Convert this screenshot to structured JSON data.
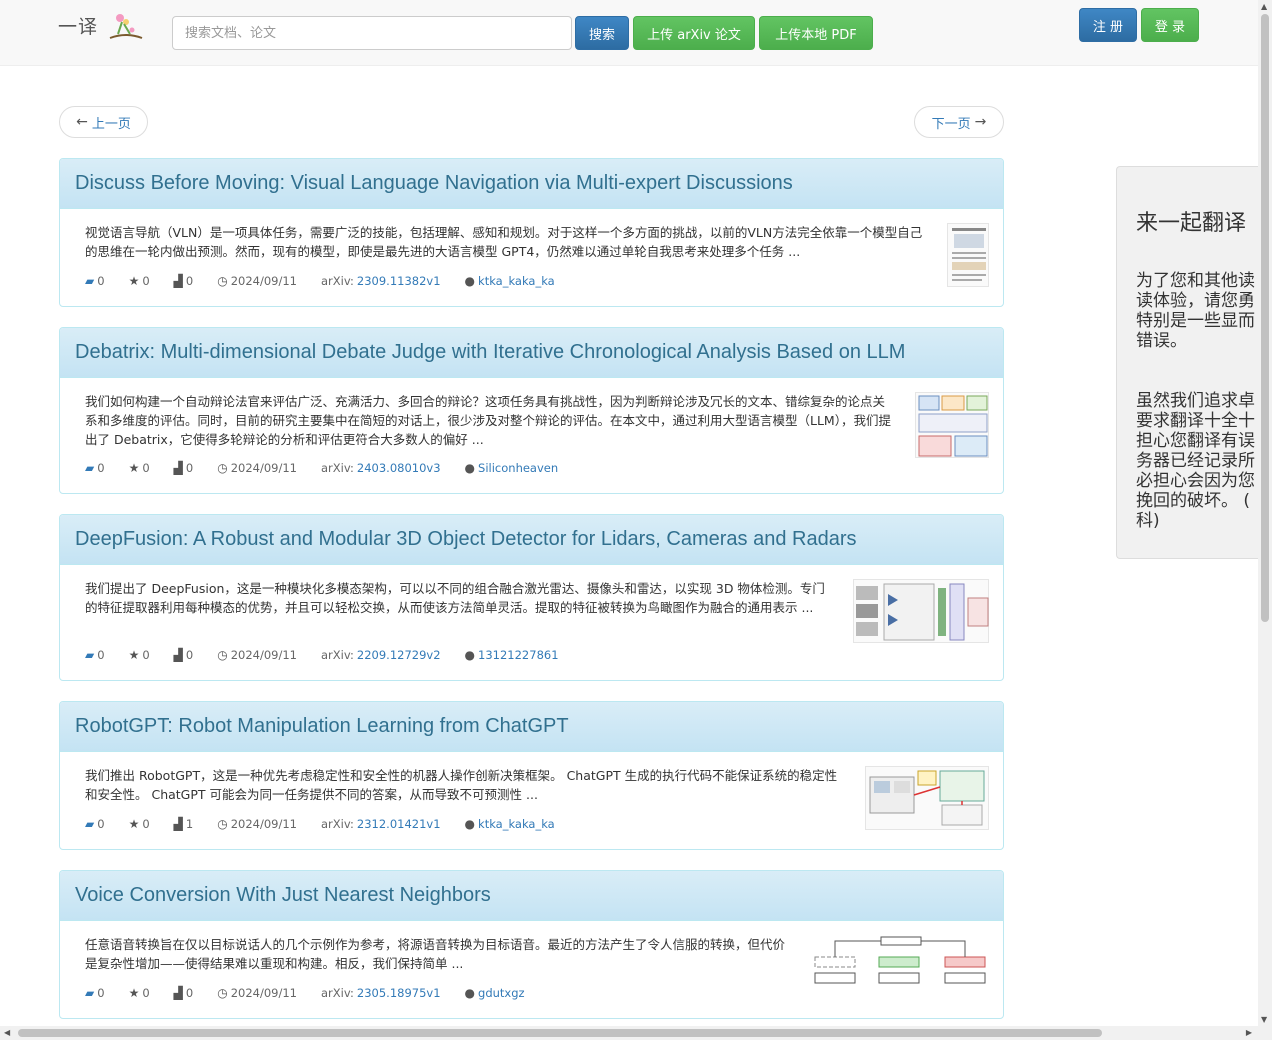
{
  "header": {
    "brand": "一译",
    "search_placeholder": "搜索文档、论文",
    "search_button": "搜索",
    "upload_arxiv": "上传 arXiv 论文",
    "upload_pdf": "上传本地 PDF",
    "register": "注 册",
    "login": "登 录"
  },
  "pager": {
    "prev": "上一页",
    "next": "下一页",
    "prev_arrow": "←",
    "next_arrow": "→"
  },
  "papers": [
    {
      "title": "Discuss Before Moving: Visual Language Navigation via Multi-expert Discussions",
      "abstract": "视觉语言导航（VLN）是一项具体任务，需要广泛的技能，包括理解、感知和规划。对于这样一个多方面的挑战，以前的VLN方法完全依靠一个模型自己的思维在一轮内做出预测。然而，现有的模型，即使是最先进的大语言模型 GPT4，仍然难以通过单轮自我思考来处理多个任务 ...",
      "comments": "0",
      "stars": "0",
      "views": "0",
      "date": "2024/09/11",
      "arxiv_prefix": "arXiv:",
      "arxiv_id": "2309.11382v1",
      "user": "ktka_kaka_ka"
    },
    {
      "title": "Debatrix: Multi-dimensional Debate Judge with Iterative Chronological Analysis Based on LLM",
      "abstract": "我们如何构建一个自动辩论法官来评估广泛、充满活力、多回合的辩论？这项任务具有挑战性，因为判断辩论涉及冗长的文本、错综复杂的论点关系和多维度的评估。同时，目前的研究主要集中在简短的对话上，很少涉及对整个辩论的评估。在本文中，通过利用大型语言模型（LLM），我们提出了 Debatrix，它使得多轮辩论的分析和评估更符合大多数人的偏好 ...",
      "comments": "0",
      "stars": "0",
      "views": "0",
      "date": "2024/09/11",
      "arxiv_prefix": "arXiv:",
      "arxiv_id": "2403.08010v3",
      "user": "Siliconheaven"
    },
    {
      "title": "DeepFusion: A Robust and Modular 3D Object Detector for Lidars, Cameras and Radars",
      "abstract": "我们提出了 DeepFusion，这是一种模块化多模态架构，可以以不同的组合融合激光雷达、摄像头和雷达，以实现 3D 物体检测。专门的特征提取器利用每种模态的优势，并且可以轻松交换，从而使该方法简单灵活。提取的特征被转换为鸟瞰图作为融合的通用表示 ...",
      "comments": "0",
      "stars": "0",
      "views": "0",
      "date": "2024/09/11",
      "arxiv_prefix": "arXiv:",
      "arxiv_id": "2209.12729v2",
      "user": "13121227861"
    },
    {
      "title": "RobotGPT: Robot Manipulation Learning from ChatGPT",
      "abstract": "我们推出 RobotGPT，这是一种优先考虑稳定性和安全性的机器人操作创新决策框架。 ChatGPT 生成的执行代码不能保证系统的稳定性和安全性。 ChatGPT 可能会为同一任务提供不同的答案，从而导致不可预测性 ...",
      "comments": "0",
      "stars": "0",
      "views": "1",
      "date": "2024/09/11",
      "arxiv_prefix": "arXiv:",
      "arxiv_id": "2312.01421v1",
      "user": "ktka_kaka_ka"
    },
    {
      "title": "Voice Conversion With Just Nearest Neighbors",
      "abstract": "任意语音转换旨在仅以目标说话人的几个示例作为参考，将源语音转换为目标语音。最近的方法产生了令人信服的转换，但代价是复杂性增加——使得结果难以重现和构建。相反，我们保持简单 ...",
      "comments": "0",
      "stars": "0",
      "views": "0",
      "date": "2024/09/11",
      "arxiv_prefix": "arXiv:",
      "arxiv_id": "2305.18975v1",
      "user": "gdutxgz"
    }
  ],
  "sidebar": {
    "title": "来一起翻译",
    "para1": [
      "为了您和其他读",
      "读体验，请您勇",
      "特别是一些显而",
      "错误。"
    ],
    "para2": [
      "虽然我们追求卓",
      "要求翻译十全十",
      "担心您翻译有误",
      "务器已经记录所",
      "必担心会因为您",
      "挽回的破坏。 (",
      "科)"
    ]
  },
  "icons": {
    "comment": "comment-icon",
    "star": "star-icon",
    "views": "stats-icon",
    "date": "clock-icon",
    "user": "user-icon"
  },
  "colors": {
    "primary": "#337ab7",
    "success": "#5cb85c",
    "panel_head": "#d9edf7",
    "title": "#31708f"
  }
}
